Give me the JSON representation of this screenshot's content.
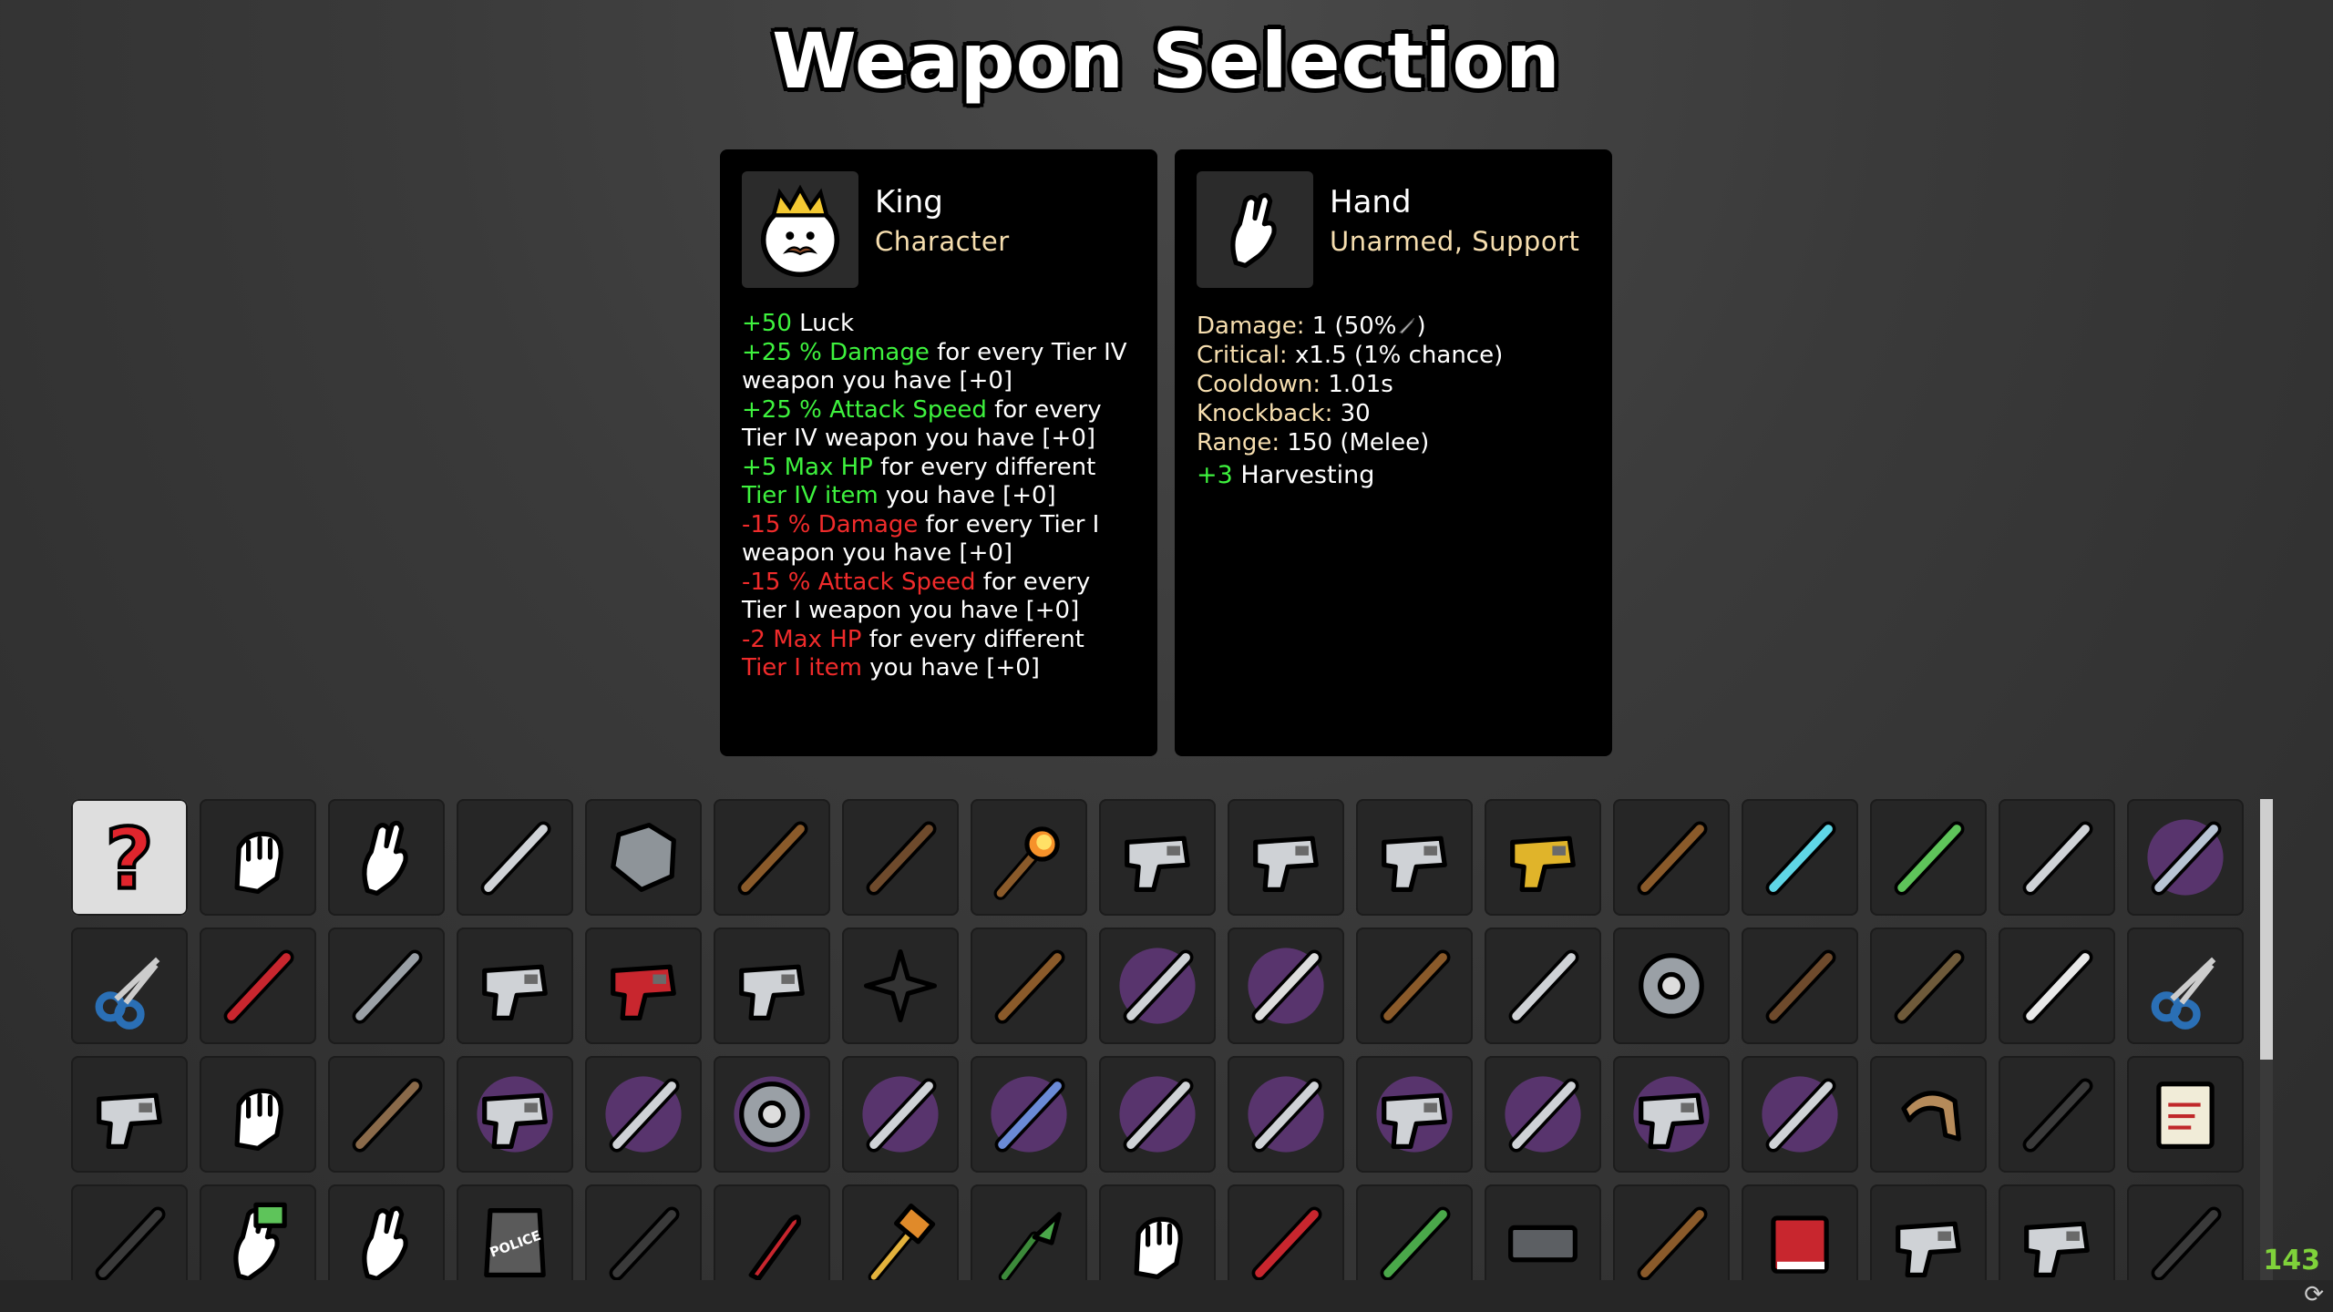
{
  "screen": {
    "title": "Weapon Selection"
  },
  "character_panel": {
    "name": "King",
    "type": "Character",
    "icon": "king-face-icon",
    "stats": [
      [
        {
          "t": "+50",
          "c": "g"
        },
        {
          "t": " Luck",
          "c": ""
        }
      ],
      [
        {
          "t": "+25 % Damage",
          "c": "g"
        },
        {
          "t": " for every Tier IV weapon you have [+0]",
          "c": ""
        }
      ],
      [
        {
          "t": "+25 % Attack Speed",
          "c": "g"
        },
        {
          "t": " for every Tier IV weapon you have [+0]",
          "c": ""
        }
      ],
      [
        {
          "t": "+5 Max HP",
          "c": "g"
        },
        {
          "t": " for every different ",
          "c": ""
        },
        {
          "t": "Tier IV item",
          "c": "g"
        },
        {
          "t": " you have [+0]",
          "c": ""
        }
      ],
      [
        {
          "t": "-15 % Damage",
          "c": "r"
        },
        {
          "t": " for every Tier I weapon you have [+0]",
          "c": ""
        }
      ],
      [
        {
          "t": "-15 % Attack Speed",
          "c": "r"
        },
        {
          "t": " for every Tier I weapon you have [+0]",
          "c": ""
        }
      ],
      [
        {
          "t": "-2 Max HP",
          "c": "r"
        },
        {
          "t": " for every different ",
          "c": ""
        },
        {
          "t": "Tier I item",
          "c": "r"
        },
        {
          "t": " you have [+0]",
          "c": ""
        }
      ]
    ]
  },
  "weapon_panel": {
    "name": "Hand",
    "type": "Unarmed, Support",
    "icon": "hand-icon",
    "damage_label": "Damage:",
    "damage_value": " 1 (50%",
    "damage_suffix": ")",
    "critical_label": "Critical:",
    "critical_value": " x1.5 (1% chance)",
    "cooldown_label": "Cooldown:",
    "cooldown_value": " 1.01s",
    "knockback_label": "Knockback:",
    "knockback_value": " 30",
    "range_label": "Range:",
    "range_value": " 150 (Melee)",
    "bonus_value": "+3",
    "bonus_label": " Harvesting"
  },
  "weapon_grid": [
    [
      "random-question-icon",
      "fist-icon",
      "hand-icon",
      "knife-icon",
      "rock-icon",
      "spear-icon",
      "stick-icon",
      "torch-icon",
      "double-barrel-pistol-icon",
      "smg-icon",
      "minigun-icon",
      "taser-icon",
      "magic-wand-icon",
      "lightning-shiv-icon",
      "thorn-club-icon",
      "shiv-icon",
      "crystal-icon"
    ],
    [
      "scissors-icon",
      "screwdriver-icon",
      "wrench-icon",
      "laser-gun-icon",
      "nail-gun-icon",
      "medical-gun-icon",
      "shuriken-icon",
      "slingshot-icon",
      "battle-axe-icon",
      "skull-scepter-icon",
      "hatchet-icon",
      "cleaver-icon",
      "shield-icon",
      "crossbow-icon",
      "flamethrower-icon",
      "lance-icon",
      "pruner-icon"
    ],
    [
      "revolver-icon",
      "claw-icon",
      "quarterstaff-icon",
      "alien-gun-icon",
      "alien-claw-icon",
      "alien-shield-icon",
      "crescent-wand-icon",
      "trident-icon",
      "sword-icon",
      "alien-bow-icon",
      "alien-cannon-icon",
      "frost-staff-icon",
      "laser-blaster-icon",
      "obliterator-icon",
      "boomerang-icon",
      "shock-stick-icon",
      "scroll-icon"
    ],
    [
      "syringe-icon",
      "cash-hand-icon",
      "glove-icon",
      "riot-shield-icon",
      "phone-icon",
      "rocket-icon",
      "hammer-icon",
      "plant-icon",
      "power-fist-icon",
      "chainsaw-icon",
      "dagger-icon",
      "keyboard-icon",
      "wooden-club-icon",
      "book-icon",
      "gatling-laser-icon",
      "robot-arm-icon",
      "radio-icon"
    ]
  ],
  "riot_shield_text": "POLICE",
  "fps": "143",
  "colors": {
    "positive": "#3ef23e",
    "negative": "#f02b2b",
    "label": "#f6deaf",
    "fps": "#7fd23a"
  }
}
